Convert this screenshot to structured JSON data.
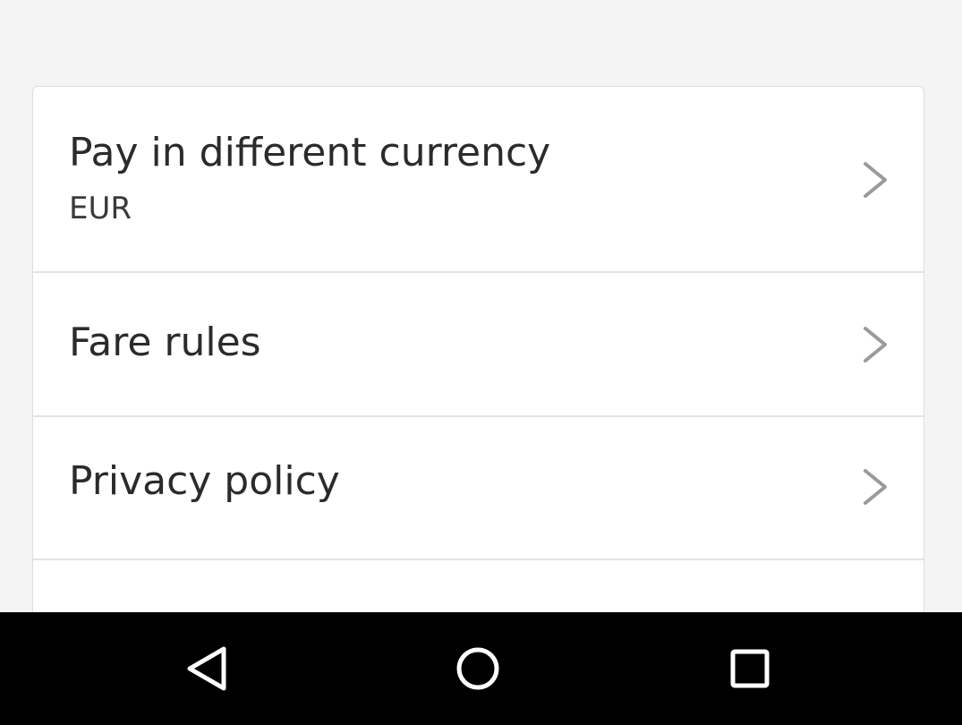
{
  "settings": {
    "items": [
      {
        "title": "Pay in different currency",
        "subtitle": "EUR",
        "icon": "chevron-right-icon"
      },
      {
        "title": "Fare rules",
        "icon": "chevron-right-icon"
      },
      {
        "title": "Privacy policy",
        "icon": "chevron-right-icon"
      }
    ]
  },
  "nav_bar": {
    "buttons": [
      {
        "icon": "back-triangle-icon"
      },
      {
        "icon": "home-circle-icon"
      },
      {
        "icon": "recent-apps-square-icon"
      }
    ]
  },
  "colors": {
    "background": "#f4f4f4",
    "card": "#ffffff",
    "text": "#2b2b2b",
    "chevron": "#9a9a9a",
    "nav_bar": "#000000",
    "nav_icon": "#ffffff"
  }
}
